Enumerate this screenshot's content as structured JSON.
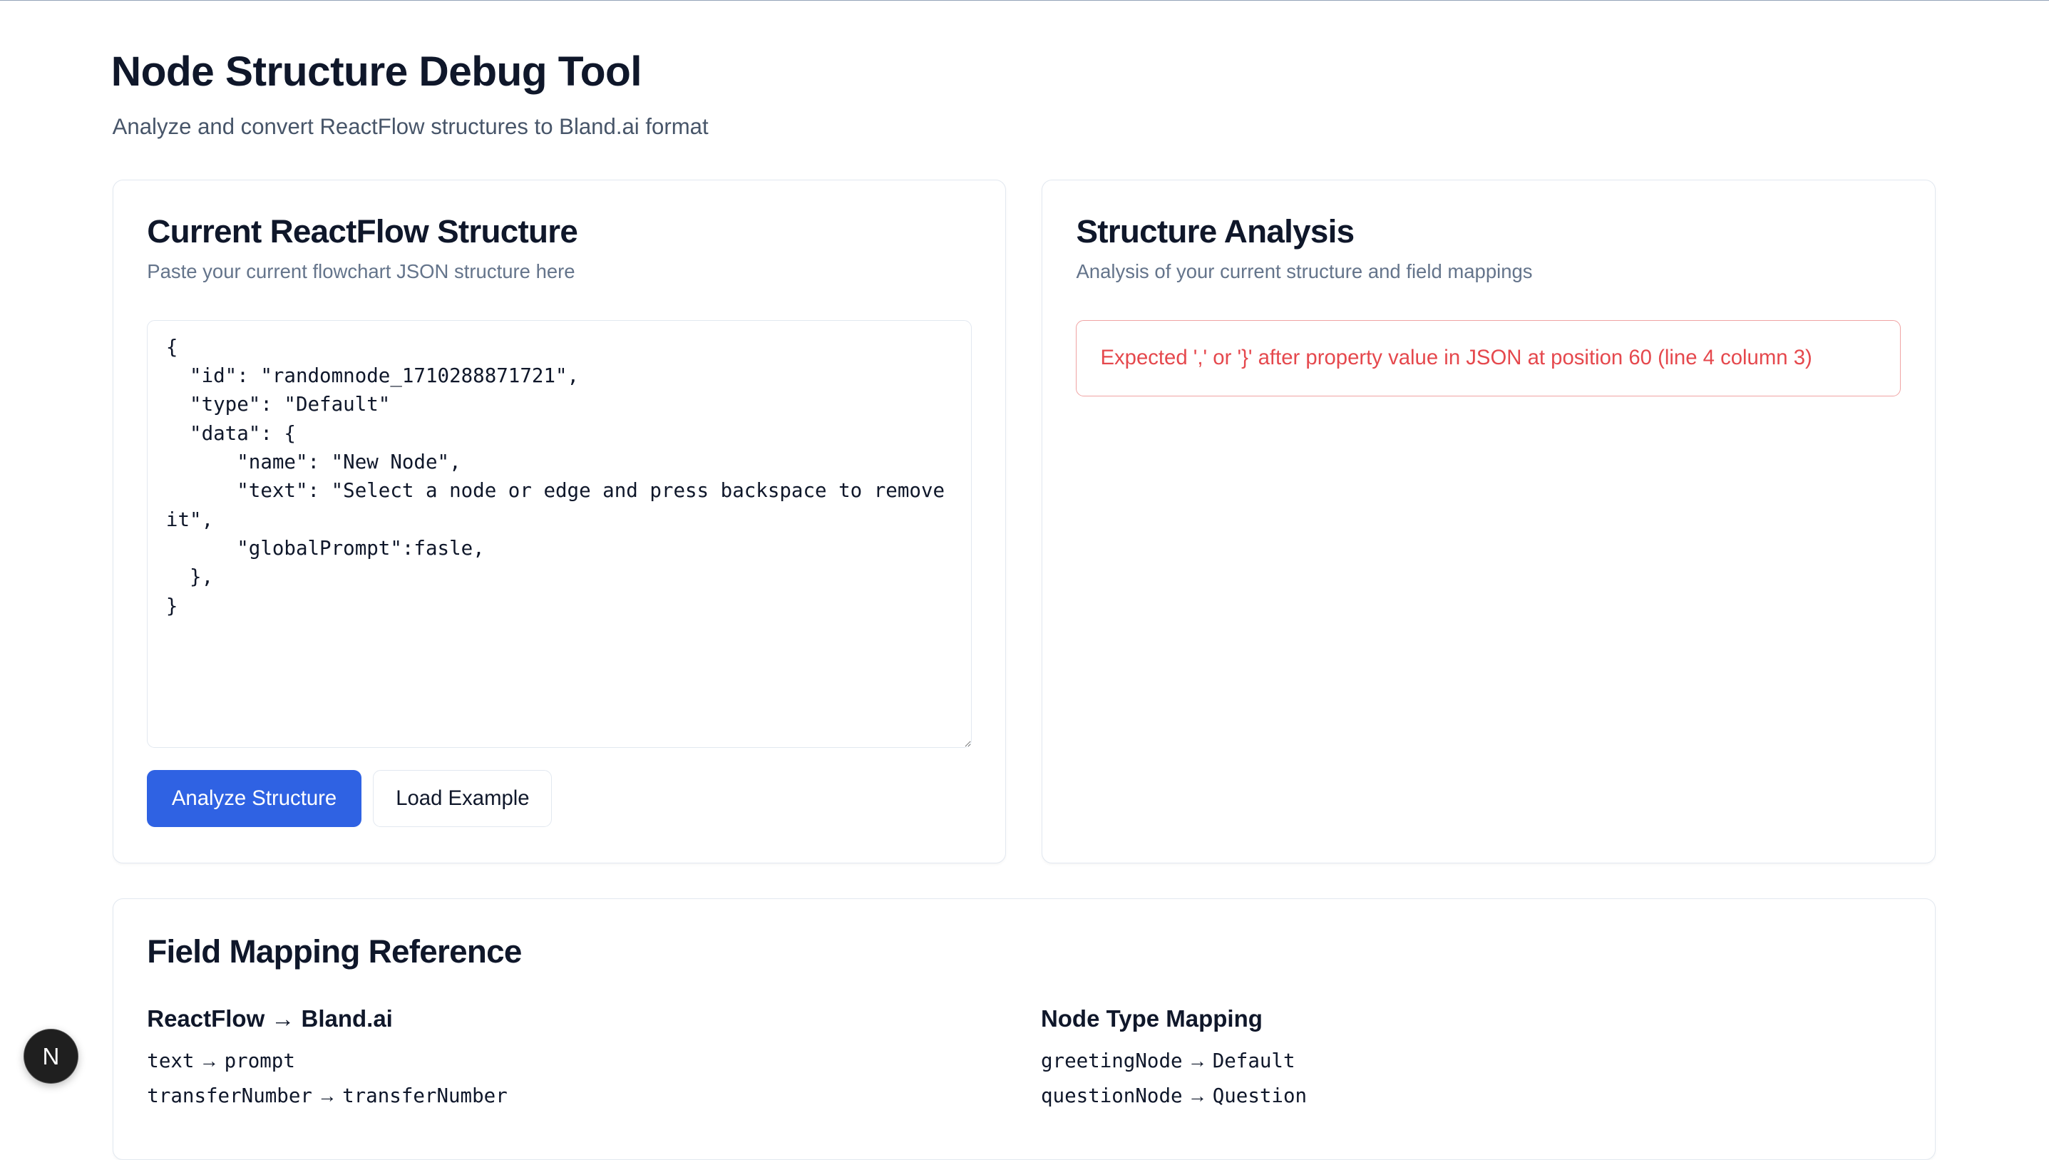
{
  "header": {
    "title": "Node Structure Debug Tool",
    "subtitle": "Analyze and convert ReactFlow structures to Bland.ai format"
  },
  "input_card": {
    "title": "Current ReactFlow Structure",
    "description": "Paste your current flowchart JSON structure here",
    "json_value": "{\n  \"id\": \"randomnode_1710288871721\",\n  \"type\": \"Default\"\n  \"data\": {\n      \"name\": \"New Node\",\n      \"text\": \"Select a node or edge and press backspace to remove it\",\n      \"globalPrompt\":fasle,\n  },\n}",
    "analyze_label": "Analyze Structure",
    "load_example_label": "Load Example"
  },
  "analysis_card": {
    "title": "Structure Analysis",
    "description": "Analysis of your current structure and field mappings",
    "error": "Expected ',' or '}' after property value in JSON at position 60 (line 4 column 3)"
  },
  "reference": {
    "title": "Field Mapping Reference",
    "field_heading": "ReactFlow → Bland.ai",
    "field_mappings": [
      {
        "from": "text",
        "to": "prompt"
      },
      {
        "from": "transferNumber",
        "to": "transferNumber"
      }
    ],
    "type_heading": "Node Type Mapping",
    "type_mappings": [
      {
        "from": "greetingNode",
        "to": "Default"
      },
      {
        "from": "questionNode",
        "to": "Question"
      }
    ],
    "arrow": "→"
  },
  "badge": {
    "letter": "N"
  },
  "colors": {
    "primary": "#2f62e3",
    "error": "#e5484d"
  }
}
